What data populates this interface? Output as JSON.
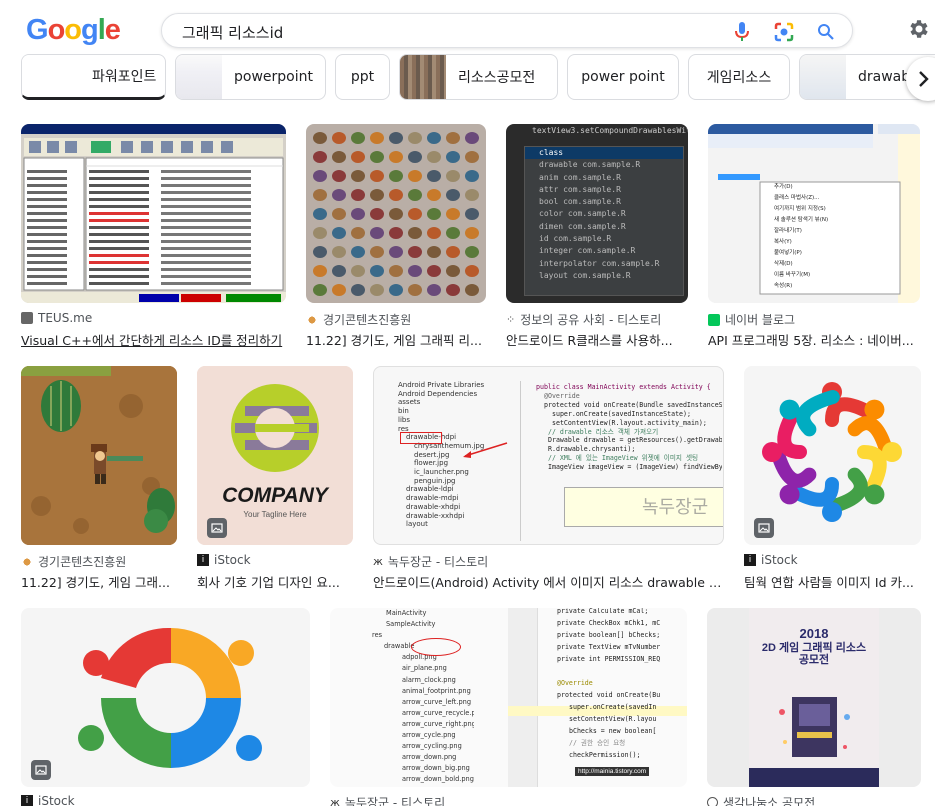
{
  "header": {
    "logo": [
      "G",
      "o",
      "o",
      "g",
      "l",
      "e"
    ],
    "logo_colors": [
      "#4285F4",
      "#EA4335",
      "#FBBC05",
      "#4285F4",
      "#34A853",
      "#EA4335"
    ],
    "search_query": "그래픽 리소스id"
  },
  "chips": [
    {
      "label": "파워포인트"
    },
    {
      "label": "powerpoint"
    },
    {
      "label": "ppt"
    },
    {
      "label": "리소스공모전"
    },
    {
      "label": "power point"
    },
    {
      "label": "게임리소스"
    },
    {
      "label": "drawab"
    }
  ],
  "results": [
    {
      "source": "TEUS.me",
      "title": "Visual C++에서 간단하게 리소스 ID를 정리하기"
    },
    {
      "source": "경기콘텐츠진흥원",
      "title": "11.22] 경기도, 게임 그래픽 리..."
    },
    {
      "source": "정보의 공유 사회 - 티스토리",
      "title": "안드로이드 R클래스를 사용하..."
    },
    {
      "source": "네이버 블로그",
      "title": "API 프로그래밍 5장. 리소스 : 네이버..."
    },
    {
      "source": "경기콘텐츠진흥원",
      "title": "11.22] 경기도, 게임 그래..."
    },
    {
      "source": "iStock",
      "title": "회사 기호 기업 디자인 요..."
    },
    {
      "source": "녹두장군 - 티스토리",
      "title": "안드로이드(Android) Activity 에서 이미지 리소스 drawable 다..."
    },
    {
      "source": "iStock",
      "title": "팀웍 연합 사람들 이미지 Id 카..."
    },
    {
      "source": "iStock",
      "title": ""
    },
    {
      "source": "녹두장군 - 티스토리",
      "title": ""
    },
    {
      "source": "생각나눔소 공모전",
      "title": ""
    }
  ],
  "image_text": {
    "code_popup_header": "textView3.setCompoundDrawablesWithI",
    "code_popup_items": [
      "class",
      "drawable com.sample.R",
      "anim com.sample.R",
      "attr com.sample.R",
      "bool com.sample.R",
      "color com.sample.R",
      "dimen com.sample.R",
      "id com.sample.R",
      "integer com.sample.R",
      "interpolator com.sample.R",
      "layout com.sample.R"
    ],
    "company_logo": "COMPANY",
    "company_tagline": "Your Tagline Here",
    "poster_year": "2018",
    "poster_title": "2D 게임 그래픽 리소스 공모전",
    "android_code": [
      "public class MainActivity extends Activity {",
      "@Override",
      "protected void onCreate(Bundle savedInstanceState) {",
      "super.onCreate(savedInstanceState);",
      "setContentView(R.layout.activity_main);",
      "// drawable 리소스 객체 가져오기",
      "Drawable drawable = getResources().getDrawable(",
      "R.drawable.chrysanti);",
      "// XML 에 있는 ImageView 위젯에 이미지 셋팅",
      "ImageView imageView = (ImageView) findViewById("
    ],
    "tree_items": [
      "Android Private Libraries",
      "Android Dependencies",
      "assets",
      "bin",
      "libs",
      "res",
      "drawable-hdpi",
      "chrysanthemum.jpg",
      "desert.jpg",
      "flower.jpg",
      "ic_launcher.png",
      "penguin.jpg",
      "drawable-ldpi",
      "drawable-mdpi",
      "drawable-xhdpi",
      "drawable-xxhdpi",
      "layout"
    ],
    "res_tree": [
      "MainActivity",
      "SampleActivity",
      "res",
      "drawable",
      "adpoll.png",
      "air_plane.png",
      "alarm_clock.png",
      "animal_footprint.png",
      "arrow_curve_left.png",
      "arrow_curve_recycle.png",
      "arrow_curve_right.png",
      "arrow_cycle.png",
      "arrow_cycling.png",
      "arrow_down.png",
      "arrow_down_big.png",
      "arrow_down_bold.png"
    ],
    "res_code": [
      "private Calculate mCal;",
      "private CheckBox mChk1, mC",
      "private boolean[] bChecks;",
      "private TextView mTvNumber",
      "private int PERMISSION_REQ",
      "@Override",
      "protected void onCreate(Bu",
      "super.onCreate(savedIn",
      "setContentView(R.layou",
      "bChecks = new boolean[",
      "// 권한 승인 요청",
      "checkPermission();"
    ],
    "res_watermark": "http://mainia.tistory.com",
    "ide_menu": [
      "추가(D)",
      "클래스 마법사(Z)...",
      "여기까지 범위 지정(S)",
      "새 솔루션 탐색기 뷰(N)",
      "잘라내기(T)",
      "복사(Y)",
      "붙여넣기(P)",
      "삭제(D)",
      "이름 바꾸기(M)",
      "속성(R)"
    ],
    "ide_shortcuts": [
      "Ctrl+Shift+X",
      "Ctrl+X",
      "Ctrl+C",
      "Ctrl+V",
      "Del",
      "F2"
    ]
  }
}
